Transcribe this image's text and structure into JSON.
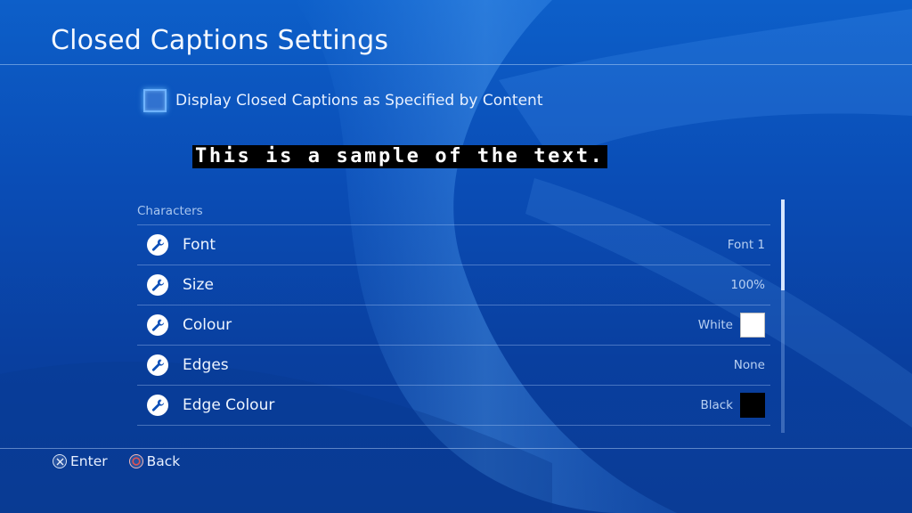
{
  "title": "Closed Captions Settings",
  "cc_toggle": {
    "label": "Display Closed Captions as Specified by Content",
    "checked": false
  },
  "sample_text": "This is a sample of the text.",
  "section": {
    "label": "Characters",
    "items": [
      {
        "label": "Font",
        "value": "Font 1"
      },
      {
        "label": "Size",
        "value": "100%"
      },
      {
        "label": "Colour",
        "value": "White",
        "swatch": "#ffffff"
      },
      {
        "label": "Edges",
        "value": "None"
      },
      {
        "label": "Edge Colour",
        "value": "Black",
        "swatch": "#000000"
      }
    ]
  },
  "footer": {
    "enter_label": "Enter",
    "back_label": "Back",
    "enter_icon": "cross-button-icon",
    "back_icon": "circle-button-icon"
  },
  "colors": {
    "background": "#0a4db6",
    "accent_focus": "#6fb3ff",
    "circle_button": "#e05050"
  }
}
